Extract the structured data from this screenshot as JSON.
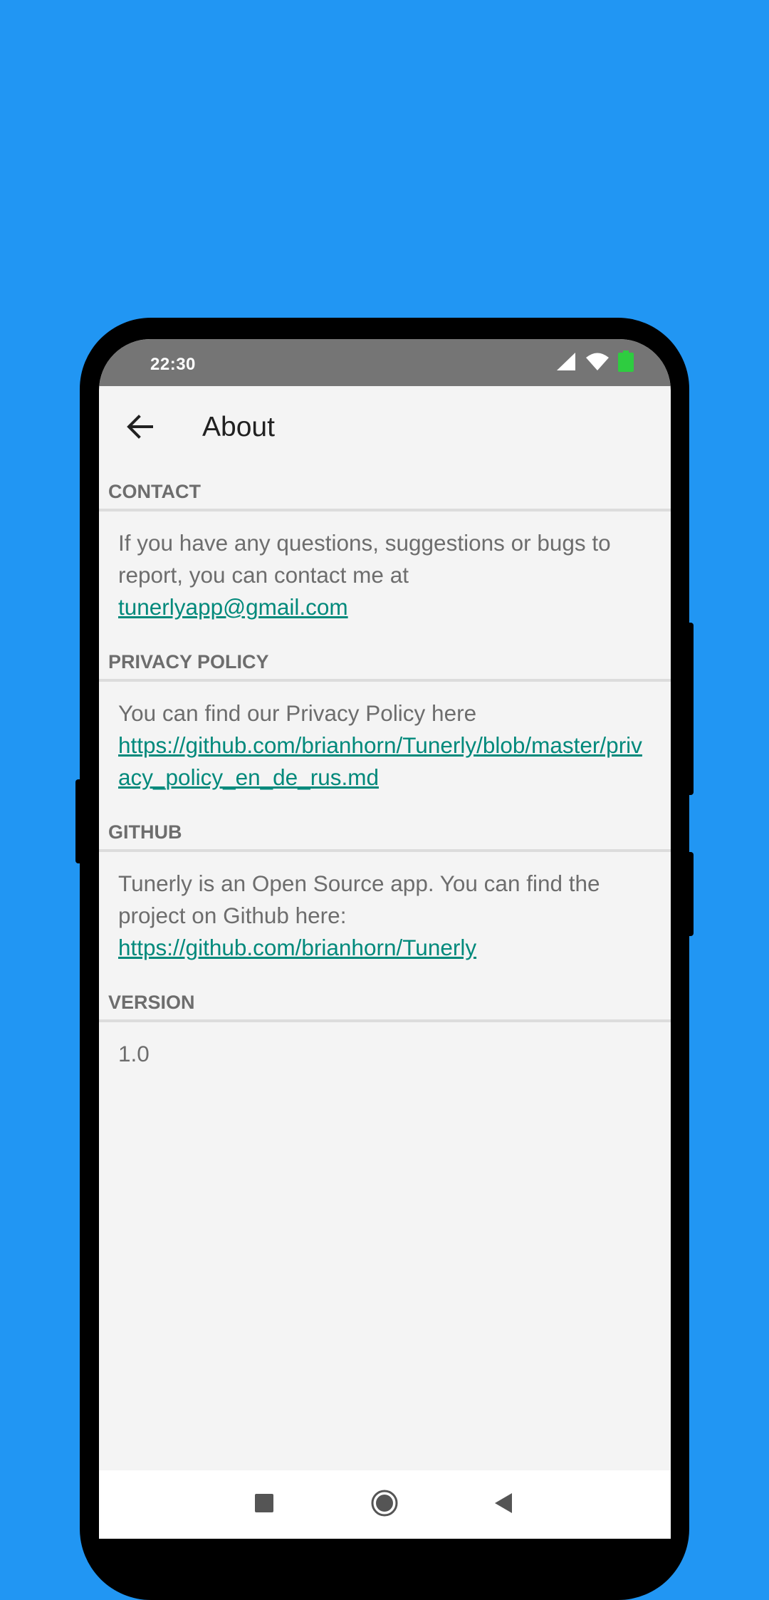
{
  "status_bar": {
    "time": "22:30"
  },
  "app_bar": {
    "title": "About",
    "back_icon": "arrow-back-icon"
  },
  "sections": [
    {
      "header": "CONTACT",
      "text": "If you have any questions, suggestions or bugs to report, you can contact me at",
      "link": "tunerlyapp@gmail.com"
    },
    {
      "header": "PRIVACY POLICY",
      "text": "You can find our Privacy Policy here",
      "link": "https://github.com/brianhorn/Tunerly/blob/master/privacy_policy_en_de_rus.md"
    },
    {
      "header": "GITHUB",
      "text": "Tunerly is an Open Source app. You can find the project on Github here:",
      "link": "https://github.com/brianhorn/Tunerly"
    },
    {
      "header": "VERSION",
      "text": "1.0"
    }
  ],
  "colors": {
    "background": "#2196F3",
    "status_bar": "#757575",
    "link": "#00897B",
    "text_secondary": "#6d6d6d"
  }
}
